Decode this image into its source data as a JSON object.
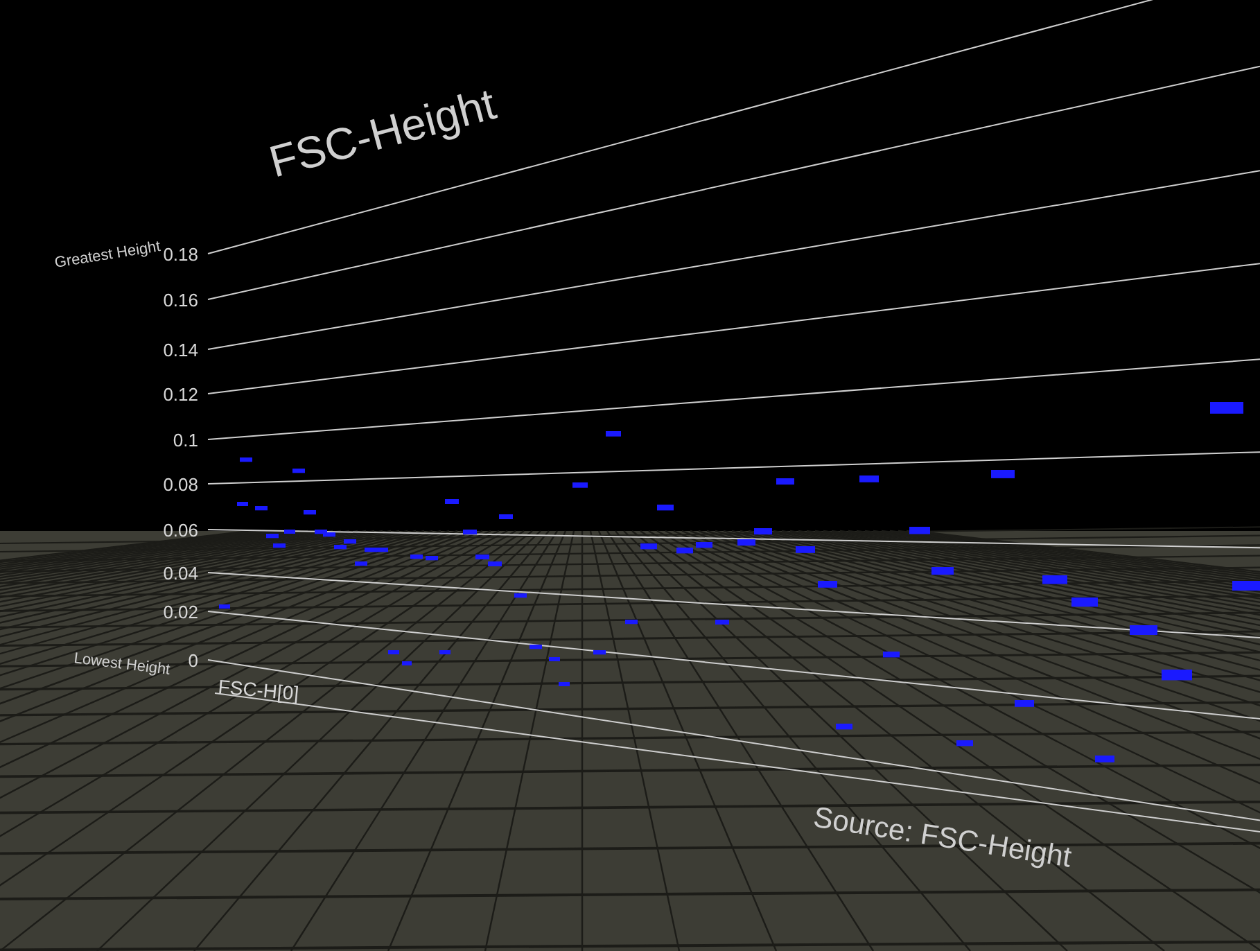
{
  "title": "FSC-Height",
  "axis": {
    "top_label": "Greatest Height",
    "bottom_label": "Lowest Height",
    "ticks": [
      "0.18",
      "0.16",
      "0.14",
      "0.12",
      "0.1",
      "0.08",
      "0.06",
      "0.04",
      "0.02",
      "0"
    ]
  },
  "x_label": "FSC-H[0]",
  "source": "Source: FSC-Height"
}
